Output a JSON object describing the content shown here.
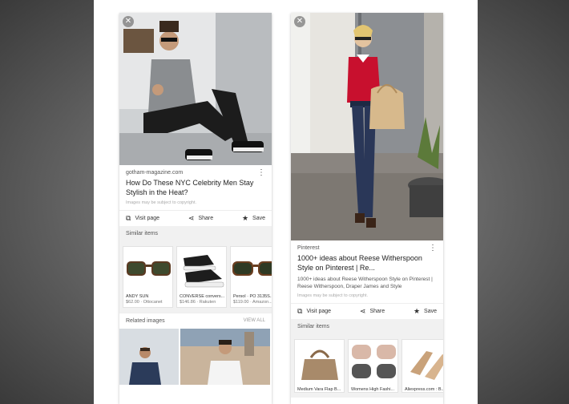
{
  "left_card": {
    "source": "gotham-magazine.com",
    "title": "How Do These NYC Celebrity Men Stay Stylish in the Heat?",
    "copyright": "Images may be subject to copyright.",
    "actions": {
      "visit": "Visit page",
      "share": "Share",
      "save": "Save"
    },
    "similar_heading": "Similar items",
    "similar": [
      {
        "label": "ANDY SUN",
        "price": "$62.00 · Ottocanet"
      },
      {
        "label": "CONVERSE convers...",
        "price": "$146.86 · Rakuten"
      },
      {
        "label": "Persol · PO 3135S...",
        "price": "$119.00 · Amazon..."
      }
    ],
    "related_heading": "Related images",
    "view_all": "VIEW ALL"
  },
  "right_card": {
    "source": "Pinterest",
    "title": "1000+ ideas about Reese Witherspoon Style on Pinterest | Re...",
    "description": "1000+ ideas about Reese Witherspoon Style on Pinterest | Reese Witherspoon, Draper James and Style",
    "copyright": "Images may be subject to copyright.",
    "actions": {
      "visit": "Visit page",
      "share": "Share",
      "save": "Save"
    },
    "similar_heading": "Similar items",
    "similar": [
      {
        "label": "Medium Vara Flap B..."
      },
      {
        "label": "Womens High Fashi..."
      },
      {
        "label": "Aliexpress.com : B..."
      }
    ]
  },
  "icons": {
    "close": "close-icon",
    "more": "more-vert-icon",
    "visit": "open-in-new-icon",
    "share": "share-icon",
    "save": "star-icon"
  }
}
